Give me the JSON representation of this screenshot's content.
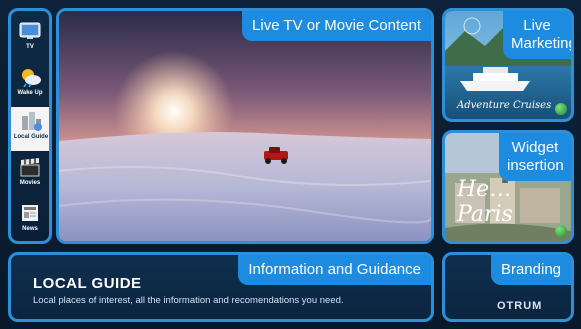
{
  "sidebar": {
    "items": [
      {
        "label": "TV",
        "icon": "tv-icon"
      },
      {
        "label": "Wake Up",
        "icon": "weather-icon"
      },
      {
        "label": "Local Guide",
        "icon": "buildings-icon",
        "active": true
      },
      {
        "label": "Movies",
        "icon": "clapperboard-icon"
      },
      {
        "label": "News",
        "icon": "newspaper-icon"
      }
    ]
  },
  "main": {
    "tag": "Live TV or Movie Content"
  },
  "live_marketing": {
    "tag": "Live Marketing",
    "caption": "Adventure Cruises"
  },
  "widget": {
    "tag": "Widget insertion",
    "script_text": "He… Paris"
  },
  "info": {
    "tag": "Information and Guidance",
    "title": "LOCAL GUIDE",
    "description": "Local places of interest, all the information and recomendations you need."
  },
  "branding": {
    "tag": "Branding",
    "logo": "OTRUM"
  },
  "colors": {
    "accent": "#1d8be0",
    "border": "#2d8fd8",
    "background": "#0b1a2c"
  }
}
